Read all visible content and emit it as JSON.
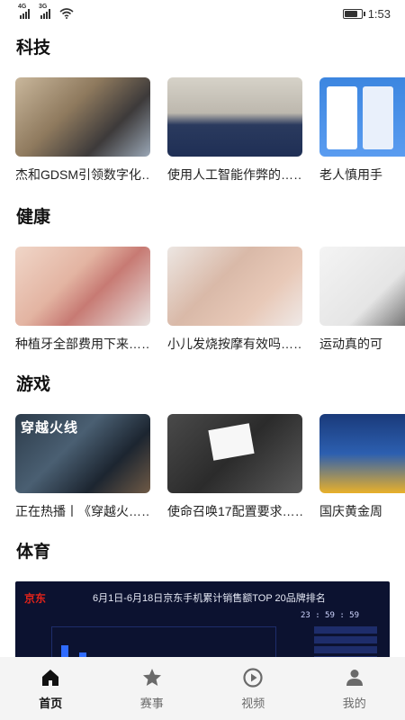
{
  "status_bar": {
    "network1": "4G",
    "network2": "3G",
    "time": "1:53"
  },
  "sections": [
    {
      "title": "科技",
      "cards": [
        {
          "caption": "杰和GDSM引领数字化……",
          "image": "tech-collage"
        },
        {
          "caption": "使用人工智能作弊的……",
          "image": "meeting-room"
        },
        {
          "caption": "老人慎用手",
          "image": "app-screens"
        }
      ]
    },
    {
      "title": "健康",
      "cards": [
        {
          "caption": "种植牙全部费用下来……",
          "image": "dental-exam"
        },
        {
          "caption": "小儿发烧按摩有效吗……",
          "image": "hand-massage"
        },
        {
          "caption": "运动真的可",
          "image": "yoga-legs"
        }
      ]
    },
    {
      "title": "游戏",
      "cards": [
        {
          "caption": "正在热播丨《穿越火……",
          "image": "drama-poster",
          "overlay": "穿越火线"
        },
        {
          "caption": "使命召唤17配置要求……",
          "image": "pc-case"
        },
        {
          "caption": "国庆黄金周",
          "image": "game-promo"
        }
      ]
    },
    {
      "title": "体育",
      "banner": {
        "logo": "京东",
        "title": "6月1日-6月18日京东手机累计销售额TOP 20品牌排名",
        "timer": "23 : 59 : 59"
      }
    }
  ],
  "tabs": [
    {
      "label": "首页",
      "icon": "home-icon",
      "active": true
    },
    {
      "label": "赛事",
      "icon": "star-icon",
      "active": false
    },
    {
      "label": "视频",
      "icon": "play-icon",
      "active": false
    },
    {
      "label": "我的",
      "icon": "user-icon",
      "active": false
    }
  ],
  "colors": {
    "tab_active": "#111111",
    "tab_inactive": "#6a6a6a",
    "tabbar_bg": "#f4f4f4",
    "brand_red": "#e2231a"
  }
}
